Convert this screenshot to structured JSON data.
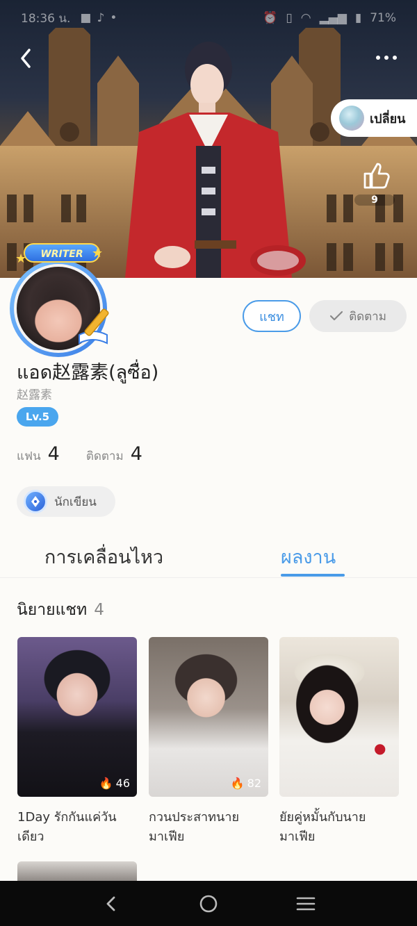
{
  "status_bar": {
    "time": "18:36 น.",
    "battery": "71%"
  },
  "header": {
    "switch_label": "เปลี่ยน",
    "like_count": "9"
  },
  "avatar": {
    "badge_text": "WRITER"
  },
  "actions": {
    "chat_label": "แชท",
    "follow_label": "ติดตาม"
  },
  "profile": {
    "name": "แอด赵露素(ลูซื่อ)",
    "subname": "赵露素",
    "level": "Lv.5",
    "fans_label": "แฟน",
    "fans_count": "4",
    "following_label": "ติดตาม",
    "following_count": "4",
    "role_label": "นักเขียน"
  },
  "tabs": {
    "activity": "การเคลื่อนไหว",
    "works": "ผลงาน",
    "active": "works"
  },
  "section": {
    "title": "นิยายแชท",
    "count": "4"
  },
  "works": [
    {
      "title_line1": "1Day รักกันแค่วัน",
      "title_line2": "เดียว",
      "views": "46"
    },
    {
      "title_line1": "กวนประสาทนาย",
      "title_line2": "มาเฟีย",
      "views": "82"
    },
    {
      "title_line1": "ยัยคู่หมั้นกับนาย",
      "title_line2": "มาเฟีย",
      "views": ""
    }
  ],
  "colors": {
    "accent": "#4a9be8",
    "level_badge": "#4aa6ee",
    "navbar": "#0a0a0a"
  },
  "icons": [
    "back-arrow-icon",
    "more-dots-icon",
    "thumbs-up-icon",
    "fire-icon",
    "check-icon",
    "pen-nib-icon",
    "nav-back-icon",
    "nav-home-icon",
    "nav-menu-icon"
  ]
}
